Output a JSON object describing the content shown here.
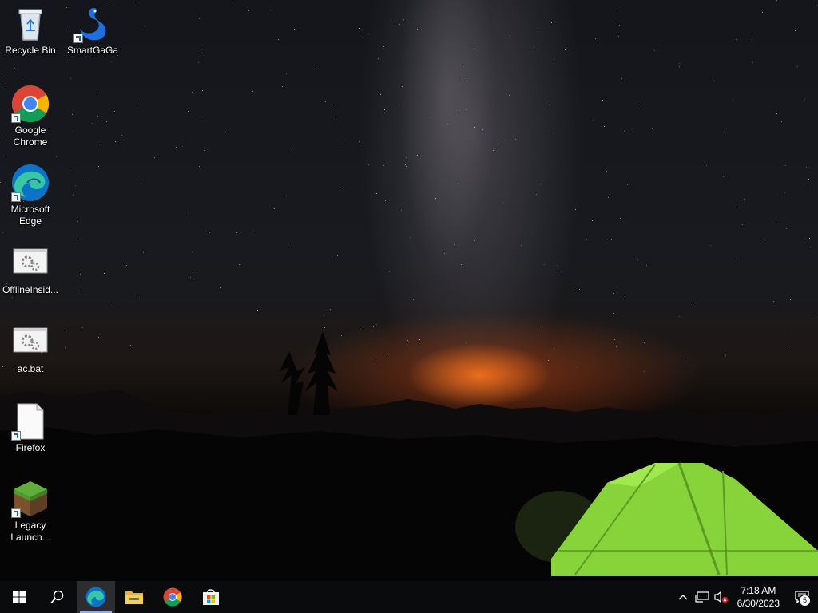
{
  "desktop": {
    "icons": [
      {
        "label": "Recycle Bin",
        "icon": "recycle-bin-icon",
        "shortcut": false
      },
      {
        "label": "SmartGaGa",
        "icon": "smartgaga-swan-icon",
        "shortcut": true
      },
      {
        "label": "Google Chrome",
        "icon": "chrome-icon",
        "shortcut": true
      },
      {
        "label": "Microsoft Edge",
        "icon": "edge-icon",
        "shortcut": true
      },
      {
        "label": "OfflineInsid...",
        "icon": "batch-file-icon",
        "shortcut": false
      },
      {
        "label": "ac.bat",
        "icon": "batch-file-icon",
        "shortcut": false
      },
      {
        "label": "Firefox",
        "icon": "blank-file-icon",
        "shortcut": true
      },
      {
        "label": "Legacy Launch...",
        "icon": "minecraft-grass-block-icon",
        "shortcut": true
      }
    ]
  },
  "taskbar": {
    "start": "windows-start-icon",
    "search": "search-icon",
    "pinned": [
      {
        "name": "edge-taskbar-icon",
        "active": true
      },
      {
        "name": "file-explorer-icon",
        "active": false
      },
      {
        "name": "chrome-taskbar-icon",
        "active": false
      },
      {
        "name": "microsoft-store-icon",
        "active": false
      }
    ],
    "tray": {
      "time": "7:18 AM",
      "date": "6/30/2023",
      "notification_count": "5"
    }
  },
  "colors": {
    "taskbar_bg": "#0a0b0d",
    "active_indicator": "#7fb4ff",
    "tent_green": "#8fe03a"
  }
}
